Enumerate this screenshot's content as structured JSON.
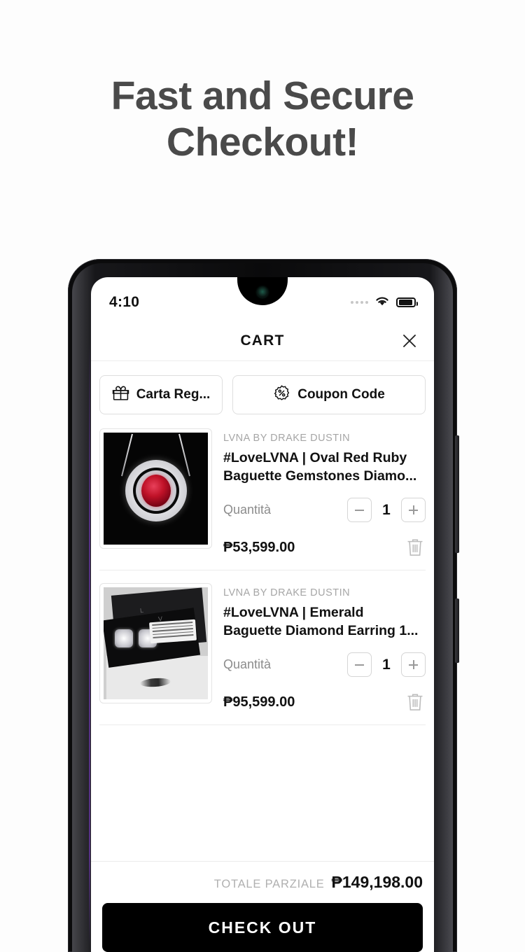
{
  "hero": {
    "line1": "Fast and Secure",
    "line2": "Checkout!"
  },
  "phone": {
    "status_bar": {
      "time": "4:10",
      "signal_icon": "signal-dots-icon",
      "wifi_icon": "wifi-icon",
      "battery_icon": "battery-icon"
    },
    "side_buttons": {
      "volume": "volume-rocker",
      "power": "power-button"
    }
  },
  "cart": {
    "header": {
      "title": "CART",
      "close_icon": "close-icon"
    },
    "actions": [
      {
        "label": "Carta Reg...",
        "icon": "gift-icon",
        "name": "gift-card-button"
      },
      {
        "label": "Coupon Code",
        "icon": "percent-badge-icon",
        "name": "coupon-code-button"
      }
    ],
    "items": [
      {
        "brand": "LVNA BY DRAKE DUSTIN",
        "title": "#LoveLVNA | Oval Red Ruby Baguette Gemstones Diamo...",
        "qty_label": "Quantità",
        "qty_value": "1",
        "price": "₱53,599.00",
        "thumb_alt": "ruby-pendant-necklace",
        "decrease_icon": "minus-icon",
        "increase_icon": "plus-icon",
        "remove_icon": "trash-icon"
      },
      {
        "brand": "LVNA BY DRAKE DUSTIN",
        "title": "#LoveLVNA | Emerald Baguette Diamond Earring 1...",
        "qty_label": "Quantità",
        "qty_value": "1",
        "price": "₱95,599.00",
        "thumb_alt": "diamond-earrings-photo",
        "decrease_icon": "minus-icon",
        "increase_icon": "plus-icon",
        "remove_icon": "trash-icon"
      }
    ],
    "footer": {
      "subtotal_label": "TOTALE PARZIALE",
      "subtotal_value": "₱149,198.00",
      "checkout_label": "CHECK OUT"
    }
  },
  "colors": {
    "page_bg": "#fdfdfd",
    "heading": "#4a4a4a",
    "accent_black": "#000000",
    "muted": "#a6a6a6",
    "border": "#dedede"
  }
}
